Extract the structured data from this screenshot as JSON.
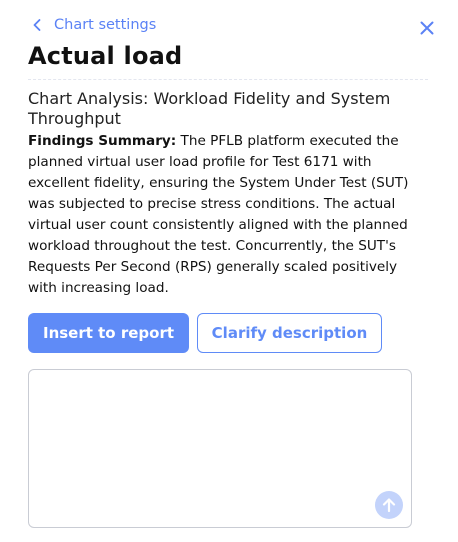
{
  "header": {
    "back_label": "Chart settings",
    "back_icon": "chevron-left-icon",
    "close_icon": "close-icon",
    "title": "Actual load"
  },
  "analysis": {
    "title": "Chart Analysis: Workload Fidelity and System Throughput",
    "summary_label": "Findings Summary:",
    "summary_text": "The PFLB platform executed the planned virtual user load profile for Test 6171 with excellent fidelity, ensuring the System Under Test (SUT) was subjected to precise stress conditions. The actual virtual user count consistently aligned with the planned workload throughout the test. Concurrently, the SUT's Requests Per Second (RPS) generally scaled positively with increasing load."
  },
  "actions": {
    "insert_label": "Insert to report",
    "clarify_label": "Clarify description"
  },
  "prompt": {
    "value": "",
    "placeholder": "",
    "send_icon": "arrow-up-icon"
  },
  "colors": {
    "accent": "#5f8bf7",
    "send_disabled": "#c3d3fb"
  }
}
